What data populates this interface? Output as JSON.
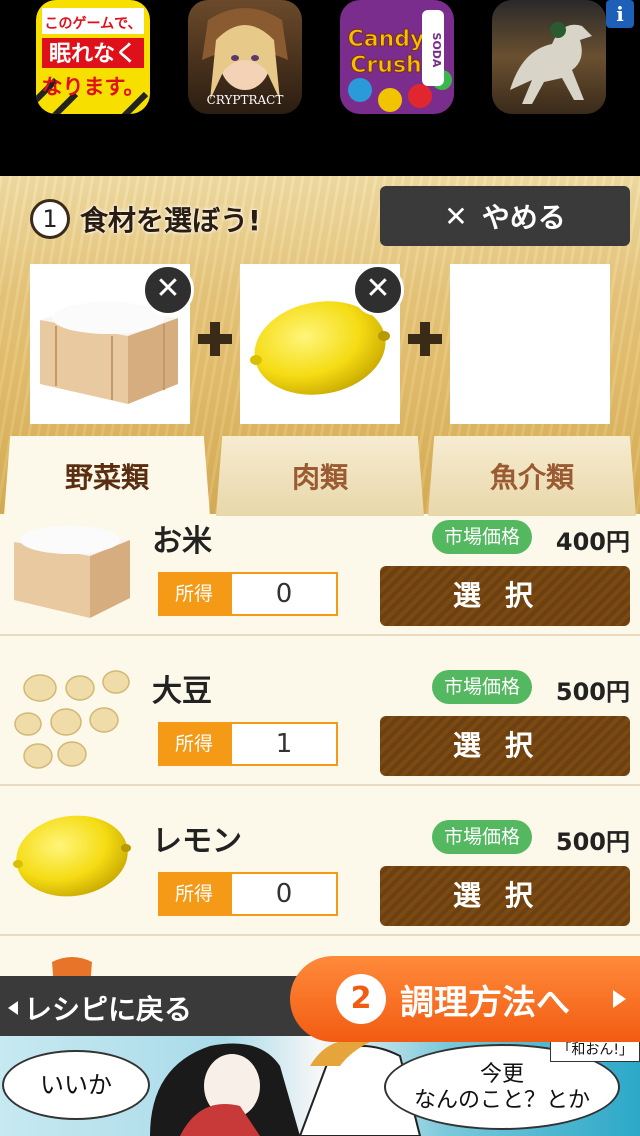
{
  "top_ad": {
    "apps": [
      {
        "name": "このゲームで、眠れなくなります。",
        "lines": [
          "このゲームで、",
          "眠れなく",
          "なります。"
        ]
      },
      {
        "name": "CRYPTRACT",
        "label": "CRYPTRACT"
      },
      {
        "name": "Candy Crush SODA",
        "label_top": "Candy",
        "label_bottom": "Crush",
        "label_side": "SODA"
      },
      {
        "name": "horse racing"
      }
    ],
    "info_label": "i"
  },
  "ingredient_picker": {
    "step_number": "1",
    "step_title": "食材を選ぼう!",
    "quit_label": "やめる",
    "remove_glyph": "✕",
    "slots": [
      {
        "item": "お米",
        "filled": true
      },
      {
        "item": "レモン",
        "filled": true
      },
      {
        "item": "",
        "filled": false
      }
    ]
  },
  "tabs": [
    {
      "label": "野菜類",
      "active": true
    },
    {
      "label": "肉類",
      "active": false
    },
    {
      "label": "魚介類",
      "active": false
    }
  ],
  "items": [
    {
      "name": "お米",
      "price_badge": "市場価格",
      "price": "400円",
      "owned_label": "所得",
      "owned": "0",
      "select_label": "選択"
    },
    {
      "name": "大豆",
      "price_badge": "市場価格",
      "price": "500円",
      "owned_label": "所得",
      "owned": "1",
      "select_label": "選択"
    },
    {
      "name": "レモン",
      "price_badge": "市場価格",
      "price": "500円",
      "owned_label": "所得",
      "owned": "0",
      "select_label": "選択"
    }
  ],
  "bottom_nav": {
    "back_label": "レシピに戻る",
    "next_number": "2",
    "next_label": "調理方法へ"
  },
  "bottom_ad": {
    "bubble_left": "いいか",
    "bubble_right_line1": "今更",
    "bubble_right_line2": "なんのこと？とか",
    "tag": "「和おん!」"
  }
}
